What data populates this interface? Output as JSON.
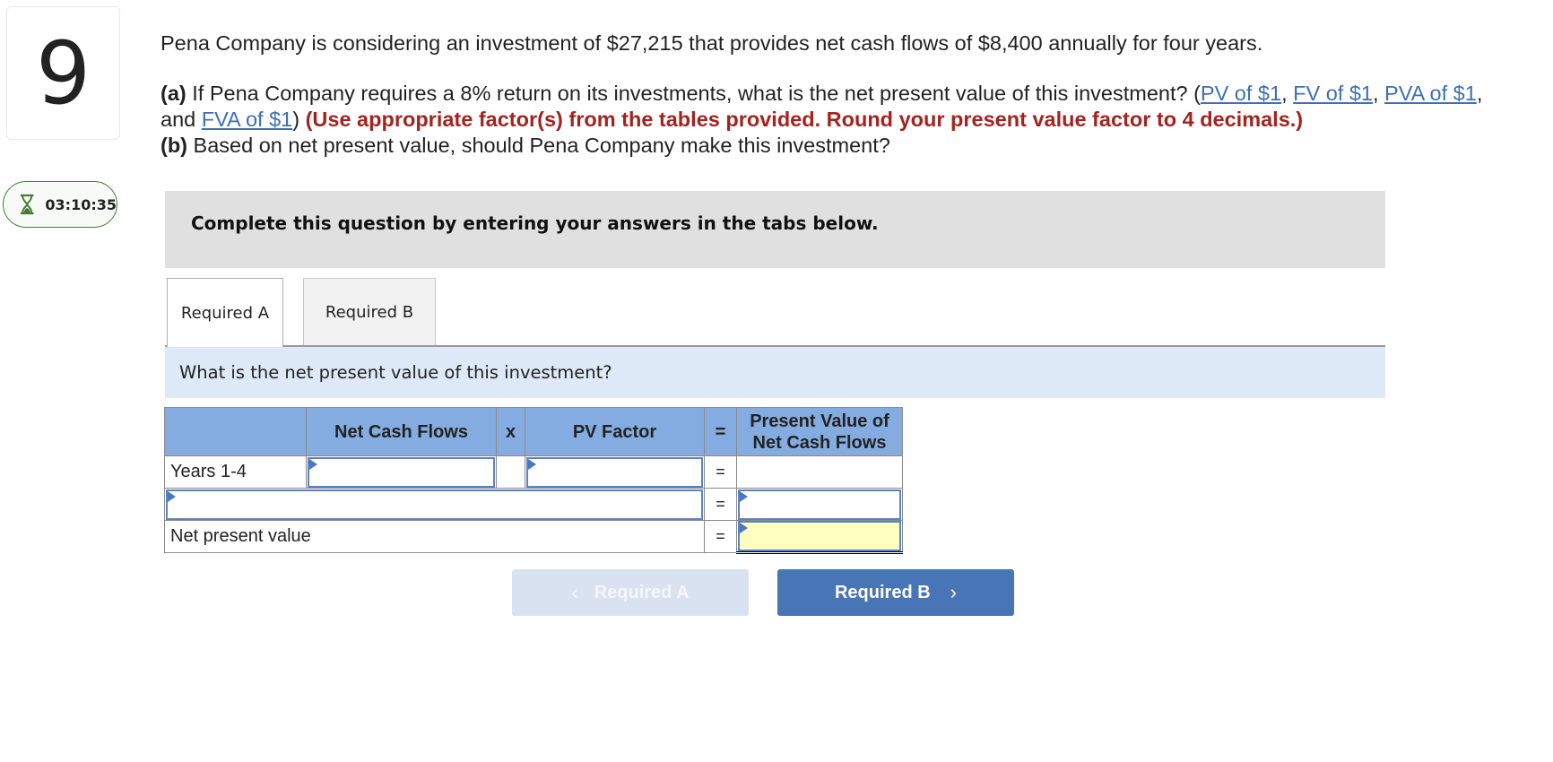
{
  "question": {
    "number": "9",
    "timer": "03:10:35",
    "intro": "Pena Company is considering an investment of $27,215 that provides net cash flows of $8,400 annually for four years.",
    "part_a_label": "(a)",
    "part_a_text": " If Pena Company requires a 8% return on its investments, what is the net present value of this investment? (",
    "links": [
      "PV of $1",
      "FV of $1",
      "PVA of $1",
      "FVA of $1"
    ],
    "sep1": ", ",
    "sep2": ", ",
    "sep3": ", and ",
    "close_paren": ")",
    "instruction": " (Use appropriate factor(s) from the tables provided. Round your present value factor to 4 decimals.)",
    "part_b_label": "(b)",
    "part_b_text": " Based on net present value, should Pena Company make this investment?"
  },
  "banner": "Complete this question by entering your answers in the tabs below.",
  "tabs": [
    {
      "label": "Required A",
      "active": true
    },
    {
      "label": "Required B",
      "active": false
    }
  ],
  "prompt": "What is the net present value of this investment?",
  "table": {
    "headers": [
      "",
      "Net Cash Flows",
      "x",
      "PV Factor",
      "=",
      "Present Value of Net Cash Flows"
    ],
    "header_pv_line1": "Present Value of",
    "header_pv_line2": "Net Cash Flows",
    "rows": [
      {
        "label": "Years 1-4",
        "net_cash_flows": "",
        "op": "",
        "pv_factor": "",
        "eq": "=",
        "present_value": ""
      },
      {
        "label": "",
        "eq": "=",
        "present_value": ""
      },
      {
        "label": "Net present value",
        "eq": "=",
        "present_value": ""
      }
    ]
  },
  "nav": {
    "prev_label": "Required A",
    "next_label": "Required B",
    "prev_icon": "‹",
    "next_icon": "›"
  },
  "colors": {
    "link": "#3d6fb6",
    "instruction_red": "#a4231f",
    "header_blue": "#85ace0",
    "button_blue": "#4775b6",
    "timer_green": "#4a7a3a",
    "total_yellow": "#ffffbf"
  }
}
